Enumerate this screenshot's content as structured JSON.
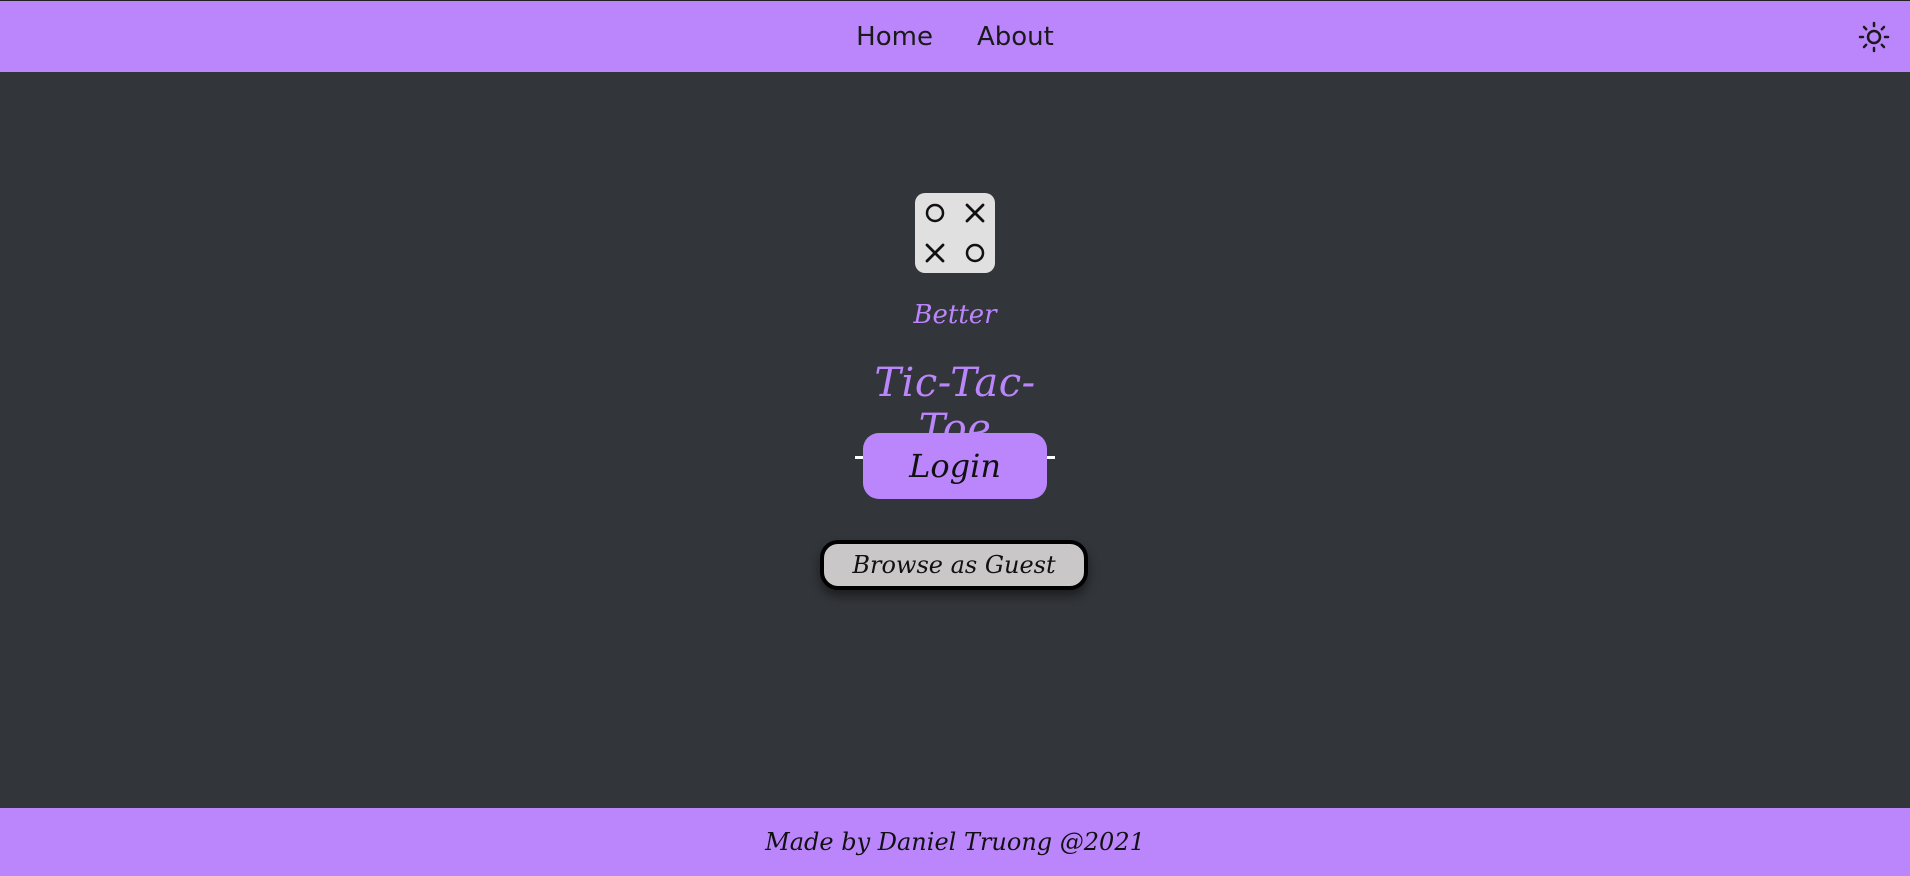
{
  "colors": {
    "accent": "#bb86fc",
    "background": "#32353a",
    "logo_bg": "#e0e0e0",
    "guest_bg": "#c9c7c7"
  },
  "header": {
    "nav": [
      {
        "label": "Home"
      },
      {
        "label": "About"
      }
    ],
    "theme_toggle_icon": "sun-icon"
  },
  "logo": {
    "icon": "tic-tac-toe-icon",
    "cells": [
      "O",
      "X",
      "X",
      "O"
    ]
  },
  "main": {
    "subtitle": "Better",
    "title": "Tic-Tac-Toe",
    "login_label": "Login",
    "guest_label": "Browse as Guest"
  },
  "footer": {
    "credit": "Made by Daniel Truong @2021"
  }
}
